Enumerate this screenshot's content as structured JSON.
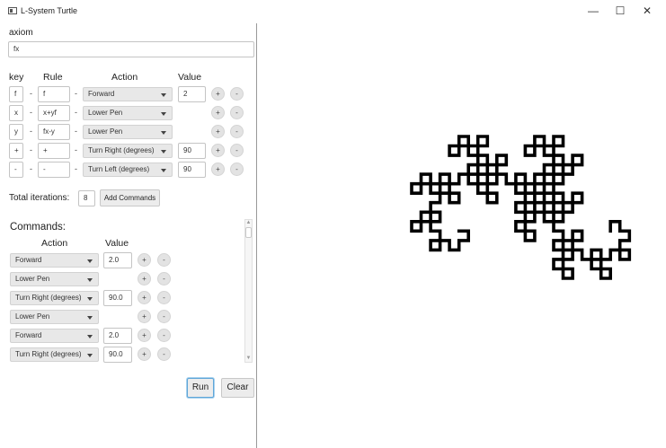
{
  "window": {
    "title": "L-System Turtle",
    "minimize": "—",
    "maximize": "☐",
    "close": "✕"
  },
  "axiom": {
    "label": "axiom",
    "value": "fx"
  },
  "rules": {
    "headers": {
      "key": "key",
      "rule": "Rule",
      "action": "Action",
      "value": "Value"
    },
    "dash": "-",
    "add_label": "+",
    "remove_label": "-",
    "rows": [
      {
        "key": "f",
        "rule": "f",
        "action": "Forward",
        "value": "2"
      },
      {
        "key": "x",
        "rule": "x+yf",
        "action": "Lower Pen",
        "value": ""
      },
      {
        "key": "y",
        "rule": "fx-y",
        "action": "Lower Pen",
        "value": ""
      },
      {
        "key": "+",
        "rule": "+",
        "action": "Turn Right (degrees)",
        "value": "90"
      },
      {
        "key": "-",
        "rule": "-",
        "action": "Turn Left (degrees)",
        "value": "90"
      }
    ]
  },
  "iterations": {
    "label": "Total iterations:",
    "value": "8",
    "add_button": "Add Commands"
  },
  "commands": {
    "title": "Commands:",
    "headers": {
      "action": "Action",
      "value": "Value"
    },
    "add_label": "+",
    "remove_label": "-",
    "rows": [
      {
        "action": "Forward",
        "value": "2.0"
      },
      {
        "action": "Lower Pen",
        "value": ""
      },
      {
        "action": "Turn Right (degrees)",
        "value": "90.0"
      },
      {
        "action": "Lower Pen",
        "value": ""
      },
      {
        "action": "Forward",
        "value": "2.0"
      },
      {
        "action": "Turn Right (degrees)",
        "value": "90.0"
      }
    ]
  },
  "buttons": {
    "run": "Run",
    "clear": "Clear"
  },
  "colors": {
    "focus": "#5fa6d8",
    "stroke": "#000000",
    "button": "#ececec"
  }
}
